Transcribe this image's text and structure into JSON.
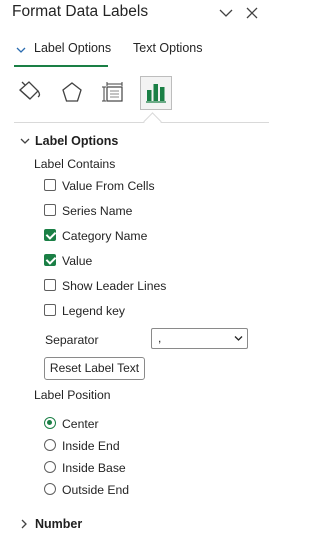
{
  "pane": {
    "title": "Format Data Labels",
    "collapse_icon": "chevron-down-icon",
    "close_icon": "close-icon"
  },
  "tabs": [
    {
      "label": "Label Options",
      "active": true
    },
    {
      "label": "Text Options",
      "active": false
    }
  ],
  "category_icons": [
    "fill-bucket-icon",
    "pentagon-effects-icon",
    "size-properties-icon",
    "bar-chart-label-options-icon"
  ],
  "sections": {
    "label_options": "Label Options",
    "label_contains": "Label Contains",
    "label_position": "Label Position",
    "number": "Number"
  },
  "checkboxes": [
    {
      "label": "Value From Cells",
      "checked": false
    },
    {
      "label": "Series Name",
      "checked": false
    },
    {
      "label": "Category Name",
      "checked": true
    },
    {
      "label": "Value",
      "checked": true
    },
    {
      "label": "Show Leader Lines",
      "checked": false
    },
    {
      "label": "Legend key",
      "checked": false
    }
  ],
  "separator": {
    "label": "Separator",
    "value": ","
  },
  "reset_button": "Reset Label Text",
  "positions": [
    {
      "label": "Center",
      "selected": true
    },
    {
      "label": "Inside End",
      "selected": false
    },
    {
      "label": "Inside Base",
      "selected": false
    },
    {
      "label": "Outside End",
      "selected": false
    }
  ],
  "colors": {
    "accent": "#1a7f45",
    "text": "#242424",
    "border": "#8a8a8a"
  }
}
